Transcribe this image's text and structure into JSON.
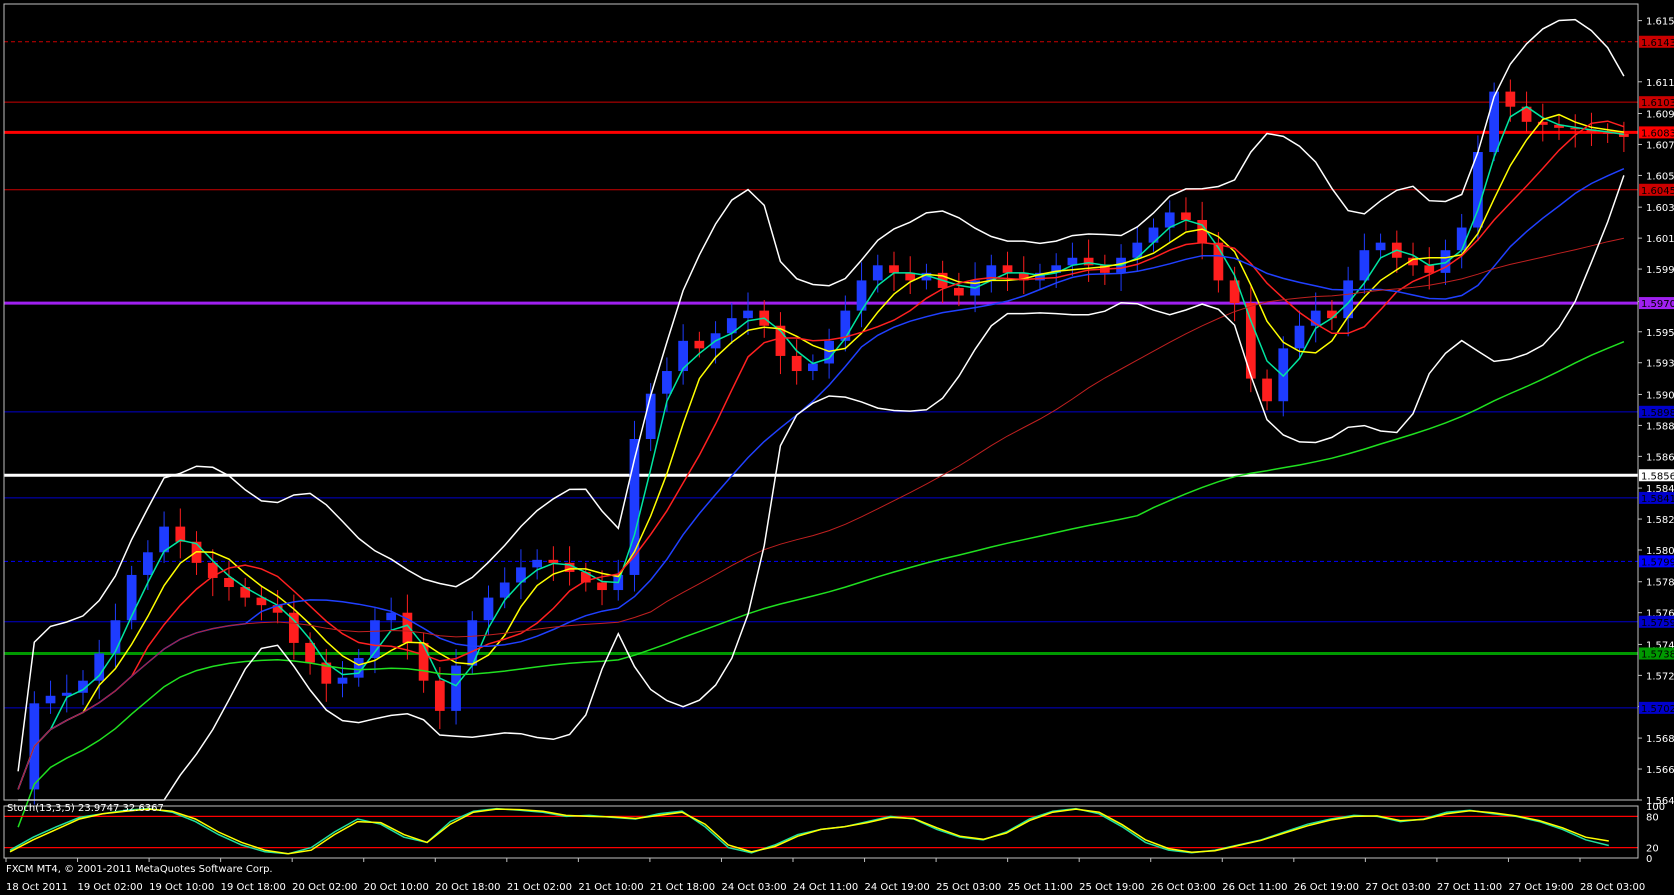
{
  "chart_data": {
    "type": "candlestick",
    "symbol_info": "FXCM MT4, © 2001-2011 MetaQuotes Software Corp.",
    "price_axis_ticks": [
      "1.61570",
      "1.61165",
      "1.60955",
      "1.60750",
      "1.60545",
      "1.60335",
      "1.60130",
      "1.59925",
      "1.59710",
      "1.59510",
      "1.59305",
      "1.59095",
      "1.58890",
      "1.58685",
      "1.58475",
      "1.58270",
      "1.58065",
      "1.57855",
      "1.57650",
      "1.57440",
      "1.57235",
      "1.57030",
      "1.56820",
      "1.56615",
      "1.56410"
    ],
    "ylim": [
      1.5641,
      1.6168
    ],
    "time_axis_labels": [
      "18 Oct 2011",
      "19 Oct 02:00",
      "19 Oct 10:00",
      "19 Oct 18:00",
      "20 Oct 02:00",
      "20 Oct 10:00",
      "20 Oct 18:00",
      "21 Oct 02:00",
      "21 Oct 10:00",
      "21 Oct 18:00",
      "24 Oct 03:00",
      "24 Oct 11:00",
      "24 Oct 19:00",
      "25 Oct 03:00",
      "25 Oct 11:00",
      "25 Oct 19:00",
      "26 Oct 03:00",
      "26 Oct 11:00",
      "26 Oct 19:00",
      "27 Oct 03:00",
      "27 Oct 11:00",
      "27 Oct 19:00",
      "28 Oct 03:00"
    ],
    "horizontal_levels": [
      {
        "price": 1.6143,
        "color": "#cc0000",
        "style": "dashed",
        "label": "1.61430"
      },
      {
        "price": 1.6103,
        "color": "#cc0000",
        "style": "solid",
        "label": "1.61030"
      },
      {
        "price": 1.6083,
        "color": "#ff0000",
        "style": "thick",
        "label": "1.60835"
      },
      {
        "price": 1.6045,
        "color": "#cc0000",
        "style": "solid",
        "label": "1.60450"
      },
      {
        "price": 1.597,
        "color": "#a020f0",
        "style": "thick",
        "label": "1.59700"
      },
      {
        "price": 1.5898,
        "color": "#0000cc",
        "style": "solid",
        "label": "1.58980"
      },
      {
        "price": 1.5856,
        "color": "#ffffff",
        "style": "thick",
        "label": "1.58560"
      },
      {
        "price": 1.5841,
        "color": "#0000cc",
        "style": "solid",
        "label": "1.58410"
      },
      {
        "price": 1.5799,
        "color": "#0000ff",
        "style": "dashed",
        "label": "1.57990"
      },
      {
        "price": 1.5759,
        "color": "#0000cc",
        "style": "solid",
        "label": "1.57590"
      },
      {
        "price": 1.5738,
        "color": "#009900",
        "style": "thick",
        "label": "1.57380"
      },
      {
        "price": 1.5702,
        "color": "#0000cc",
        "style": "solid",
        "label": "1.57020"
      }
    ],
    "close_series": [
      1.5648,
      1.5705,
      1.571,
      1.5712,
      1.572,
      1.5738,
      1.576,
      1.579,
      1.5805,
      1.5822,
      1.5812,
      1.5798,
      1.5788,
      1.5782,
      1.5775,
      1.577,
      1.5765,
      1.5745,
      1.5732,
      1.5718,
      1.5722,
      1.5735,
      1.576,
      1.5765,
      1.5745,
      1.572,
      1.57,
      1.573,
      1.576,
      1.5775,
      1.5785,
      1.5795,
      1.58,
      1.5798,
      1.5792,
      1.5785,
      1.578,
      1.579,
      1.588,
      1.591,
      1.5925,
      1.5945,
      1.594,
      1.595,
      1.596,
      1.5965,
      1.5955,
      1.5935,
      1.5925,
      1.593,
      1.5945,
      1.5965,
      1.5985,
      1.5995,
      1.599,
      1.5985,
      1.599,
      1.598,
      1.5975,
      1.5985,
      1.5995,
      1.599,
      1.5985,
      1.599,
      1.5995,
      1.6,
      1.5995,
      1.599,
      1.6,
      1.601,
      1.602,
      1.603,
      1.6025,
      1.601,
      1.5985,
      1.597,
      1.592,
      1.5905,
      1.594,
      1.5955,
      1.5965,
      1.596,
      1.5985,
      1.6005,
      1.601,
      1.6,
      1.5995,
      1.599,
      1.6005,
      1.602,
      1.607,
      1.611,
      1.61,
      1.609,
      1.6088,
      1.6086,
      1.6085,
      1.6083,
      1.6082,
      1.608
    ],
    "stochastic": {
      "label": "Stoch(13,3,5) 23.9747 32.6367",
      "levels": [
        80,
        20
      ],
      "ticks": [
        "100",
        "80",
        "20",
        "0"
      ],
      "main": [
        15,
        40,
        60,
        78,
        85,
        92,
        95,
        88,
        70,
        45,
        25,
        12,
        8,
        20,
        50,
        75,
        65,
        40,
        30,
        70,
        90,
        95,
        92,
        88,
        80,
        82,
        78,
        75,
        85,
        90,
        60,
        20,
        10,
        25,
        45,
        55,
        60,
        70,
        80,
        75,
        55,
        40,
        35,
        50,
        75,
        90,
        95,
        85,
        60,
        30,
        15,
        10,
        15,
        25,
        35,
        50,
        65,
        75,
        82,
        80,
        70,
        75,
        88,
        92,
        85,
        80,
        70,
        55,
        35,
        23.97
      ],
      "signal": [
        12,
        35,
        55,
        75,
        85,
        90,
        94,
        90,
        75,
        50,
        30,
        15,
        8,
        15,
        45,
        70,
        68,
        45,
        30,
        65,
        88,
        94,
        93,
        90,
        82,
        80,
        79,
        76,
        82,
        88,
        65,
        25,
        12,
        22,
        42,
        55,
        60,
        68,
        78,
        76,
        58,
        42,
        36,
        48,
        72,
        88,
        94,
        88,
        64,
        35,
        18,
        11,
        14,
        24,
        34,
        48,
        62,
        73,
        80,
        81,
        72,
        74,
        85,
        91,
        87,
        81,
        72,
        58,
        40,
        32.64
      ]
    },
    "stoch_ylim": [
      0,
      100
    ]
  }
}
